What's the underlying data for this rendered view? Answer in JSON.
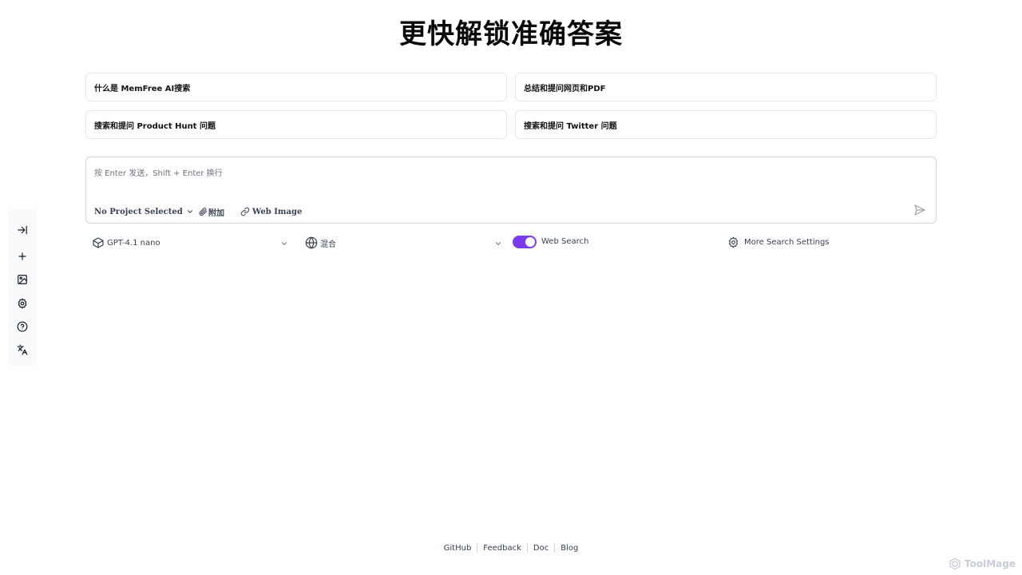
{
  "page": {
    "title": "更快解锁准确答案"
  },
  "sidebar": {
    "items": [
      {
        "name": "expand-sidebar",
        "icon": "arrow-right-to-line-icon"
      },
      {
        "name": "new-chat",
        "icon": "plus-icon"
      },
      {
        "name": "images",
        "icon": "image-icon"
      },
      {
        "name": "settings",
        "icon": "gear-icon"
      },
      {
        "name": "help",
        "icon": "help-circle-icon"
      },
      {
        "name": "language",
        "icon": "translate-icon"
      }
    ]
  },
  "suggestions": [
    "什么是 MemFree AI搜索",
    "总结和提问网页和PDF",
    "搜索和提问 Product Hunt 问题",
    "搜索和提问 Twitter 问题"
  ],
  "prompt": {
    "value": "",
    "placeholder": "按 Enter 发送，Shift + Enter 换行",
    "project_label": "No Project Selected",
    "attach_label": "附加",
    "web_image_label": "Web Image"
  },
  "controls": {
    "model": "GPT-4.1 nano",
    "source": "混合",
    "web_search_label": "Web Search",
    "web_search_on": true,
    "more_settings_label": "More Search Settings",
    "accent_color": "#7c3aed"
  },
  "footer": {
    "links": [
      "GitHub",
      "Feedback",
      "Doc",
      "Blog"
    ]
  },
  "watermark": {
    "text": "ToolMage"
  }
}
